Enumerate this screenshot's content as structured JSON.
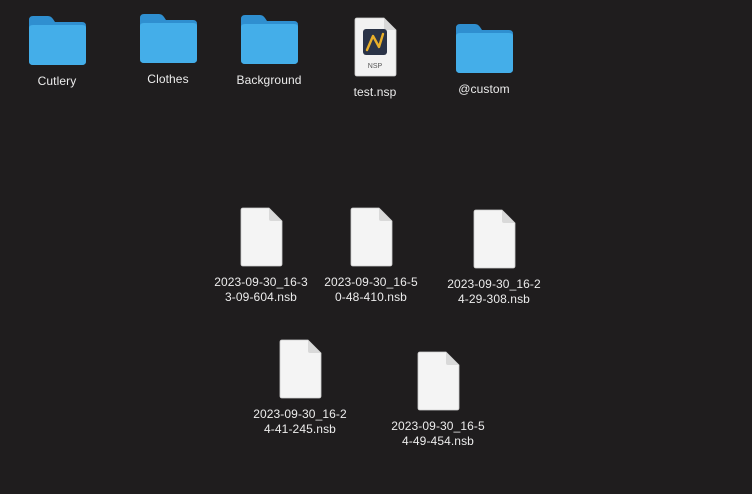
{
  "desktop": {
    "folders": [
      {
        "label": "Cutlery",
        "icon": "folder-icon"
      },
      {
        "label": "Clothes",
        "icon": "folder-icon"
      },
      {
        "label": "Background",
        "icon": "folder-icon"
      },
      {
        "label": "@custom",
        "icon": "folder-icon"
      }
    ],
    "app_file": {
      "label": "test.nsp",
      "badge": "NSP",
      "icon": "nsp-file-icon"
    },
    "files": [
      {
        "label": "2023-09-30_16-3\n3-09-604.nsb",
        "icon": "document-icon"
      },
      {
        "label": "2023-09-30_16-5\n0-48-410.nsb",
        "icon": "document-icon"
      },
      {
        "label": "2023-09-30_16-2\n4-29-308.nsb",
        "icon": "document-icon"
      },
      {
        "label": "2023-09-30_16-2\n4-41-245.nsb",
        "icon": "document-icon"
      },
      {
        "label": "2023-09-30_16-5\n4-49-454.nsb",
        "icon": "document-icon"
      }
    ]
  },
  "colors": {
    "background": "#1f1d1e",
    "folder_blue": "#3ea7e6",
    "label_text": "#ececec"
  }
}
